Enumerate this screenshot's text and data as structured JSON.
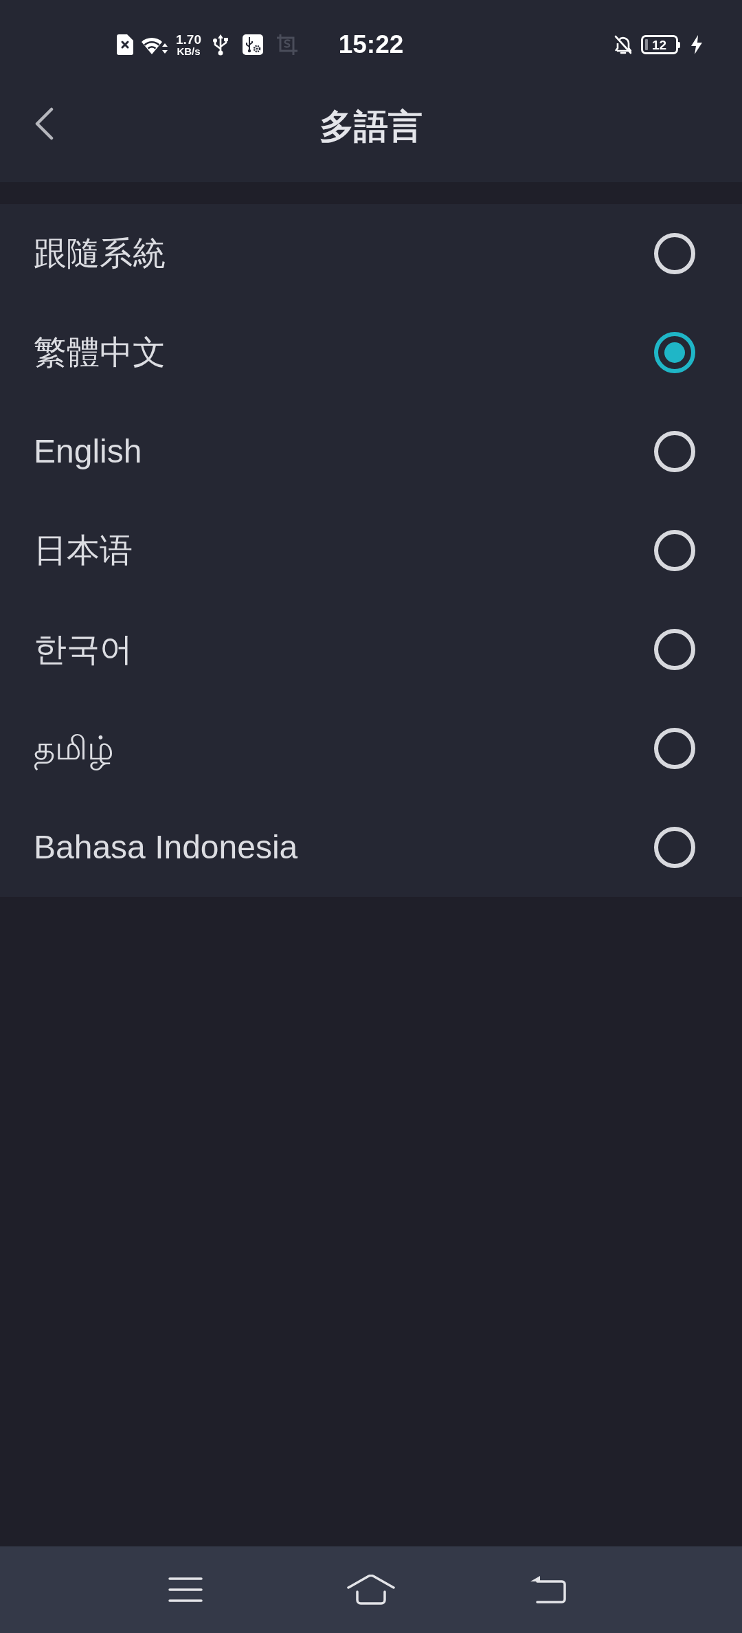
{
  "status_bar": {
    "net_speed": "1.70",
    "net_speed_unit": "KB/s",
    "time": "15:22",
    "battery": "12"
  },
  "header": {
    "title": "多語言"
  },
  "languages": [
    {
      "label": "跟隨系統",
      "selected": false
    },
    {
      "label": "繁體中文",
      "selected": true
    },
    {
      "label": "English",
      "selected": false
    },
    {
      "label": "日本语",
      "selected": false
    },
    {
      "label": "한국어",
      "selected": false
    },
    {
      "label": "தமிழ்",
      "selected": false
    },
    {
      "label": "Bahasa Indonesia",
      "selected": false
    }
  ]
}
